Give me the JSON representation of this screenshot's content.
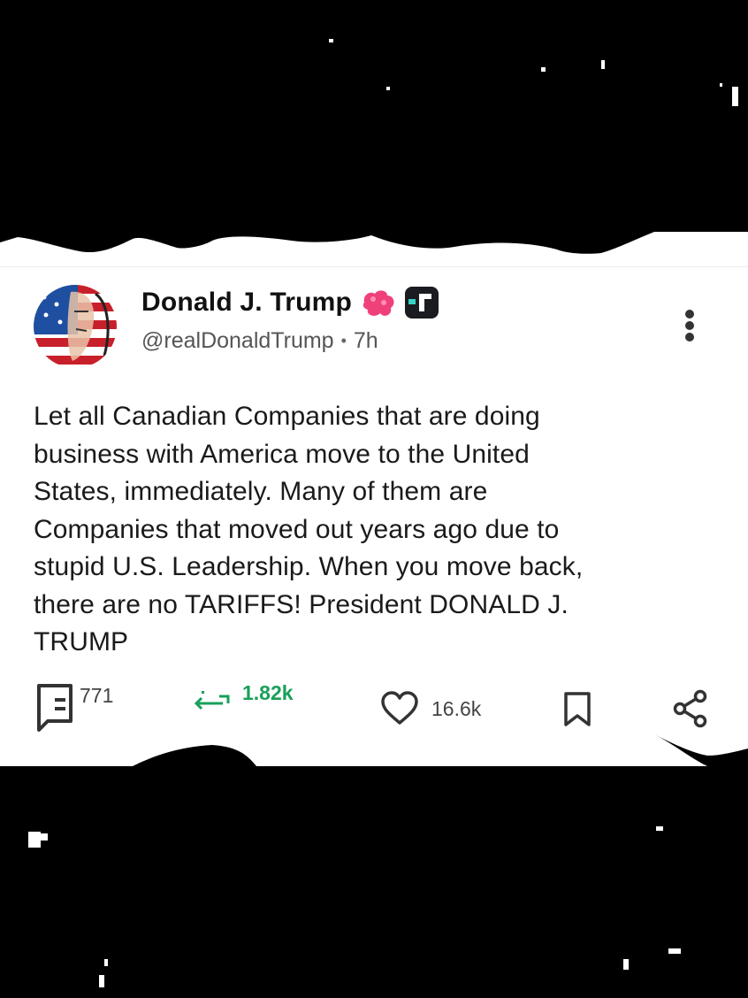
{
  "post": {
    "author_name": "Donald J. Trump",
    "handle": "@realDonaldTrump",
    "separator": "•",
    "time_ago": "7h",
    "body_lines": [
      "Let all Canadian Companies that are doing",
      "business with America move to the United",
      "States, immediately. Many of them are",
      "Companies that moved out years ago due to",
      "stupid U.S. Leadership. When you move back,",
      "there are no TARIFFS! President DONALD J.",
      "TRUMP"
    ]
  },
  "actions": {
    "replies": "771",
    "retruths": "1.82k",
    "likes": "16.6k"
  },
  "colors": {
    "retruth_green": "#18a05a",
    "badge_pink": "#f0407a",
    "text": "#1a1a1a"
  },
  "icons": [
    "avatar-flag",
    "pink-badge-icon",
    "app-badge-icon",
    "more-vertical-icon",
    "reply-icon",
    "retruth-icon",
    "like-heart-icon",
    "bookmark-icon",
    "share-icon"
  ]
}
